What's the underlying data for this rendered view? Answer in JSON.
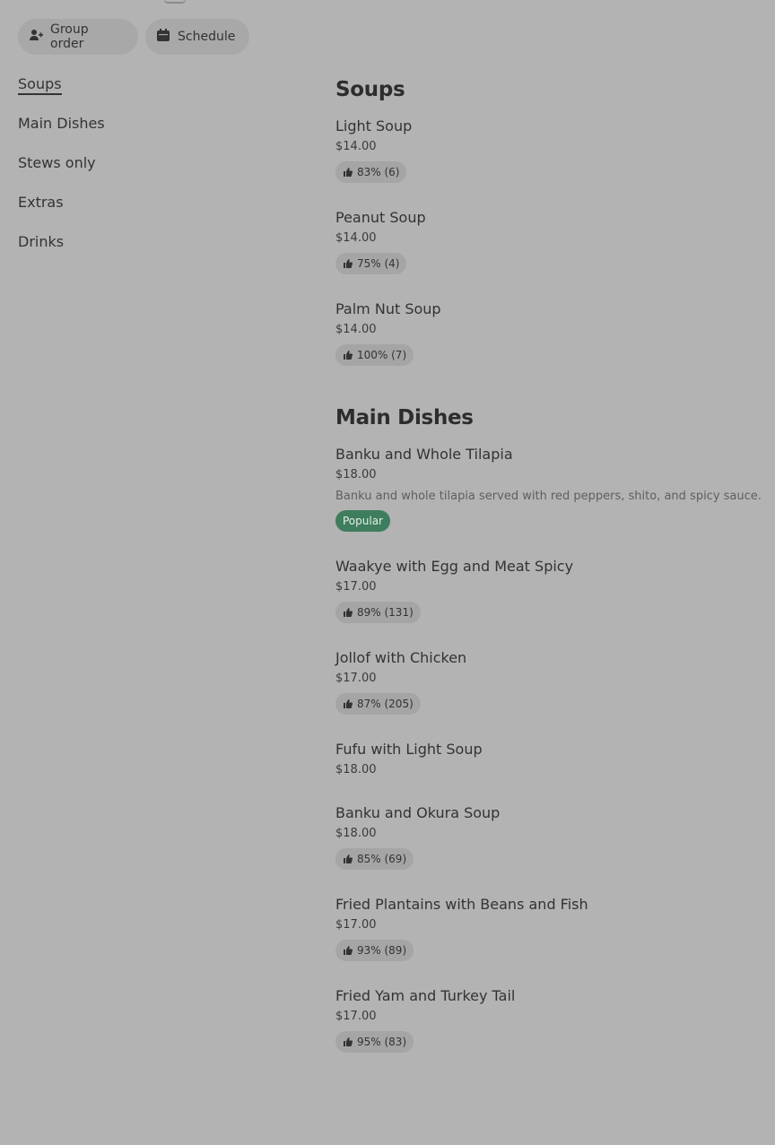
{
  "toolbar": {
    "group_order": "Group order",
    "schedule": "Schedule"
  },
  "nav": {
    "items": [
      "Soups",
      "Main Dishes",
      "Stews only",
      "Extras",
      "Drinks"
    ],
    "active": "Soups"
  },
  "sections": [
    {
      "title": "Soups",
      "items": [
        {
          "name": "Light Soup",
          "price": "$14.00",
          "rating": "83% (6)"
        },
        {
          "name": "Peanut Soup",
          "price": "$14.00",
          "rating": "75% (4)"
        },
        {
          "name": "Palm Nut Soup",
          "price": "$14.00",
          "rating": "100% (7)"
        }
      ]
    },
    {
      "title": "Main Dishes",
      "items": [
        {
          "name": "Banku and Whole Tilapia",
          "price": "$18.00",
          "description": "Banku and whole tilapia served with red peppers, shito, and spicy sauce.",
          "tag": "Popular"
        },
        {
          "name": "Waakye with Egg and Meat Spicy",
          "price": "$17.00",
          "rating": "89% (131)"
        },
        {
          "name": "Jollof with Chicken",
          "price": "$17.00",
          "rating": "87% (205)"
        },
        {
          "name": "Fufu with Light Soup",
          "price": "$18.00"
        },
        {
          "name": "Banku and Okura Soup",
          "price": "$18.00",
          "rating": "85% (69)"
        },
        {
          "name": "Fried Plantains with Beans and Fish",
          "price": "$17.00",
          "rating": "93% (89)"
        },
        {
          "name": "Fried Yam and Turkey Tail",
          "price": "$17.00",
          "rating": "95% (83)"
        }
      ]
    }
  ],
  "colors": {
    "background": "#b3b3b3",
    "popular_badge": "#3e7d5d"
  }
}
